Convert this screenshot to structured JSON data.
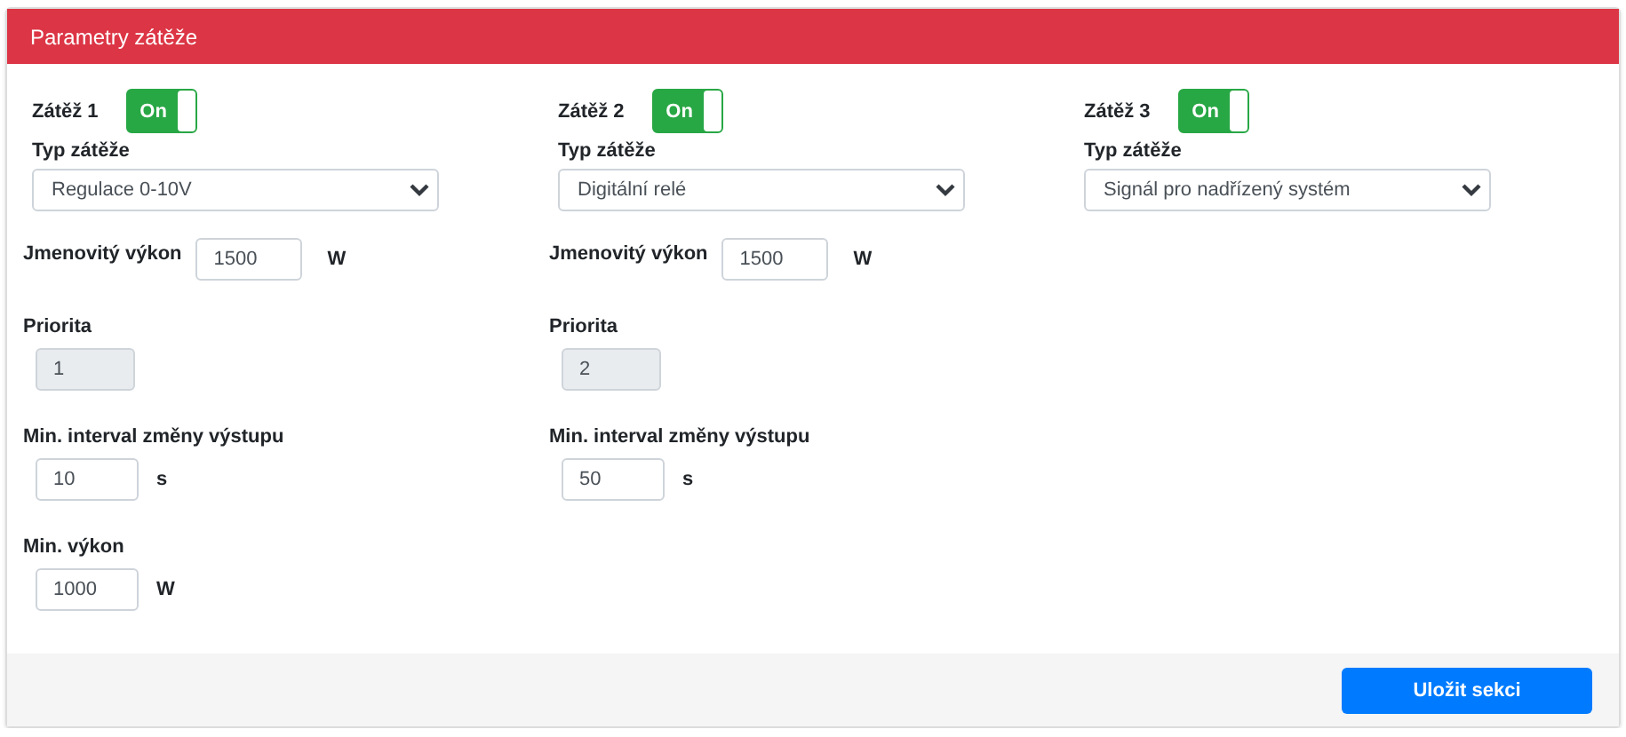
{
  "card": {
    "title": "Parametry zátěže"
  },
  "loads": [
    {
      "label": "Zátěž 1",
      "on": true,
      "toggle_text": "On",
      "type_label": "Typ zátěže",
      "type_value": "Regulace 0-10V",
      "fields": [
        {
          "kind": "inline",
          "label": "Jmenovitý výkon",
          "value": "1500",
          "unit": "W",
          "disabled": false
        },
        {
          "kind": "stacked",
          "label": "Priorita",
          "value": "1",
          "disabled": true
        },
        {
          "kind": "stacked",
          "label": "Min. interval změny výstupu",
          "value": "10",
          "unit": "s",
          "disabled": false
        },
        {
          "kind": "stacked",
          "label": "Min. výkon",
          "value": "1000",
          "unit": "W",
          "disabled": false
        }
      ]
    },
    {
      "label": "Zátěž 2",
      "on": true,
      "toggle_text": "On",
      "type_label": "Typ zátěže",
      "type_value": "Digitální relé",
      "fields": [
        {
          "kind": "inline",
          "label": "Jmenovitý výkon",
          "value": "1500",
          "unit": "W",
          "disabled": false
        },
        {
          "kind": "stacked",
          "label": "Priorita",
          "value": "2",
          "disabled": true
        },
        {
          "kind": "stacked",
          "label": "Min. interval změny výstupu",
          "value": "50",
          "unit": "s",
          "disabled": false
        }
      ]
    },
    {
      "label": "Zátěž 3",
      "on": true,
      "toggle_text": "On",
      "type_label": "Typ zátěže",
      "type_value": "Signál pro nadřízený systém"
    }
  ],
  "footer": {
    "save_button": "Uložit sekci"
  }
}
